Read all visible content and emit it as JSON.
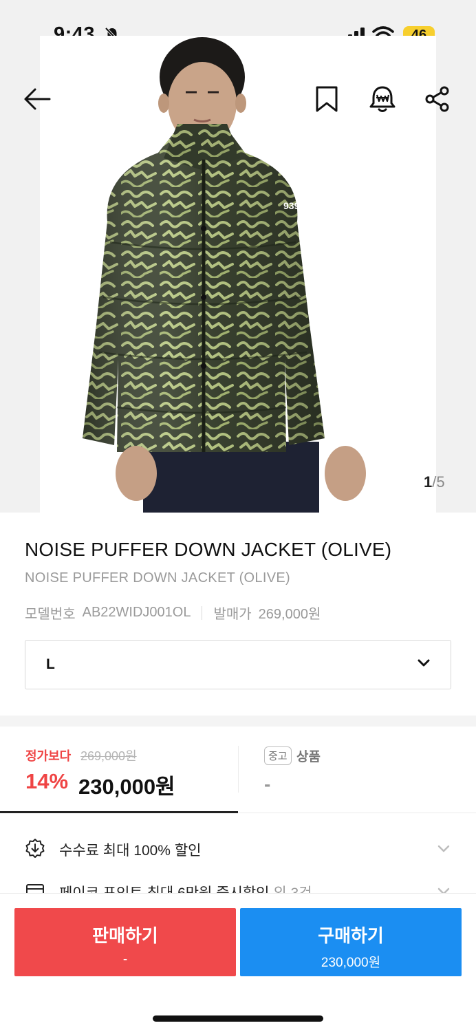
{
  "status_bar": {
    "time": "9:43",
    "battery": "46",
    "icons": [
      "bell-slash-icon",
      "cellular-signal-icon",
      "wifi-icon",
      "battery-icon"
    ]
  },
  "header": {
    "icons": [
      "back-arrow-icon",
      "bookmark-icon",
      "price-alarm-bell-icon",
      "share-icon"
    ]
  },
  "gallery": {
    "current": "1",
    "separator": "/",
    "total": "5"
  },
  "product": {
    "title": "NOISE PUFFER DOWN JACKET (OLIVE)",
    "subtitle": "NOISE PUFFER DOWN JACKET (OLIVE)",
    "model_label": "모델번호",
    "model_value": "AB22WIDJ001OL",
    "release_label": "발매가",
    "release_value": "269,000원",
    "print_text": "939"
  },
  "size_select": {
    "selected": "L"
  },
  "price_tabs": {
    "new": {
      "label": "정가보다",
      "original": "269,000원",
      "discount": "14%",
      "price": "230,000원"
    },
    "used": {
      "badge": "중고",
      "label": "상품",
      "value": "-"
    }
  },
  "benefits": [
    {
      "text": "수수료 최대 100% 할인",
      "extra": ""
    },
    {
      "text": "페이코 포인트 최대 6만원 즉시할인",
      "extra": " 외 3건"
    }
  ],
  "actions": {
    "sell_label": "판매하기",
    "sell_sub": "-",
    "buy_label": "구매하기",
    "buy_sub": "230,000원"
  },
  "colors": {
    "sell": "#f0494b",
    "buy": "#1b8ef2",
    "discount": "#ef4444",
    "battery": "#f7cf2e"
  }
}
